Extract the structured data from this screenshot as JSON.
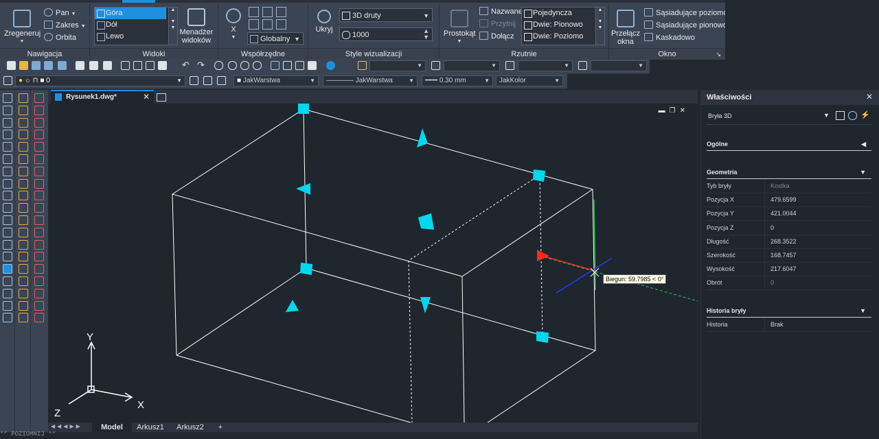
{
  "colors": {
    "accent": "#1f8fe0",
    "grip": "#00d8f0",
    "tooltip_bg": "#ffffe6",
    "polar_red": "#ff2a1a"
  },
  "ribbon": {
    "nav": {
      "title": "Nawigacja",
      "regen": "Zregeneruj",
      "pan": "Pan",
      "zakres": "Zakres",
      "orbita": "Orbita"
    },
    "views": {
      "title": "Widoki",
      "items": [
        "Góra",
        "Dół",
        "Lewo"
      ],
      "manager": "Menadżer widoków"
    },
    "coords": {
      "title": "Współrzędne",
      "x": "X",
      "combo": "Globalny"
    },
    "styles": {
      "title": "Style wizualizacji",
      "combo": "3D druty",
      "value": "1000",
      "hide": "Ukryj"
    },
    "viewports": {
      "title": "Rzutnie",
      "rect": "Prostokąt",
      "named": "Nazwane",
      "clip": "Przytnij",
      "join": "Dołącz",
      "list": [
        "Pojedyncza",
        "Dwie:  Pionowo",
        "Dwie:  Poziomo"
      ]
    },
    "window": {
      "title": "Okno",
      "switch": "Przełącz okna",
      "horizontal": "Sąsiadujące poziomo",
      "vertical": "Sąsiadujące pionowo",
      "cascade": "Kaskadowo"
    }
  },
  "toolbar2": {
    "layer": "0",
    "color": "JakWarstwa",
    "linetype": "JakWarstwa",
    "lineweight": "0.30 mm",
    "plotstyle": "JakKolor"
  },
  "document": {
    "tab": "Rysunek1.dwg*"
  },
  "canvas": {
    "tooltip": "Biegun: 59.7985 < 0°",
    "axis_x": "X",
    "axis_y": "Y",
    "axis_z": "Z"
  },
  "layout_tabs": [
    "Model",
    "Arkusz1",
    "Arkusz2",
    "+"
  ],
  "command": "** POZIOMNIJ **",
  "props": {
    "title": "Właściwości",
    "selection": "Bryła 3D",
    "general": "Ogólne",
    "geometry": "Geometria",
    "rows": [
      {
        "label": "Tyb bryły",
        "value": "Kostka",
        "dim": true
      },
      {
        "label": "Pozycja X",
        "value": "479.6599",
        "dim": false
      },
      {
        "label": "Pozycja Y",
        "value": "421.0044",
        "dim": false
      },
      {
        "label": "Pozycja Z",
        "value": "0",
        "dim": false
      },
      {
        "label": "Długość",
        "value": "268.3522",
        "dim": false
      },
      {
        "label": "Szerokość",
        "value": "168.7457",
        "dim": false
      },
      {
        "label": "Wysokość",
        "value": "217.6047",
        "dim": false
      },
      {
        "label": "Obrót",
        "value": "0",
        "dim": true
      }
    ],
    "history": "Historia bryły",
    "history_row": {
      "label": "Historia",
      "value": "Brak"
    }
  }
}
